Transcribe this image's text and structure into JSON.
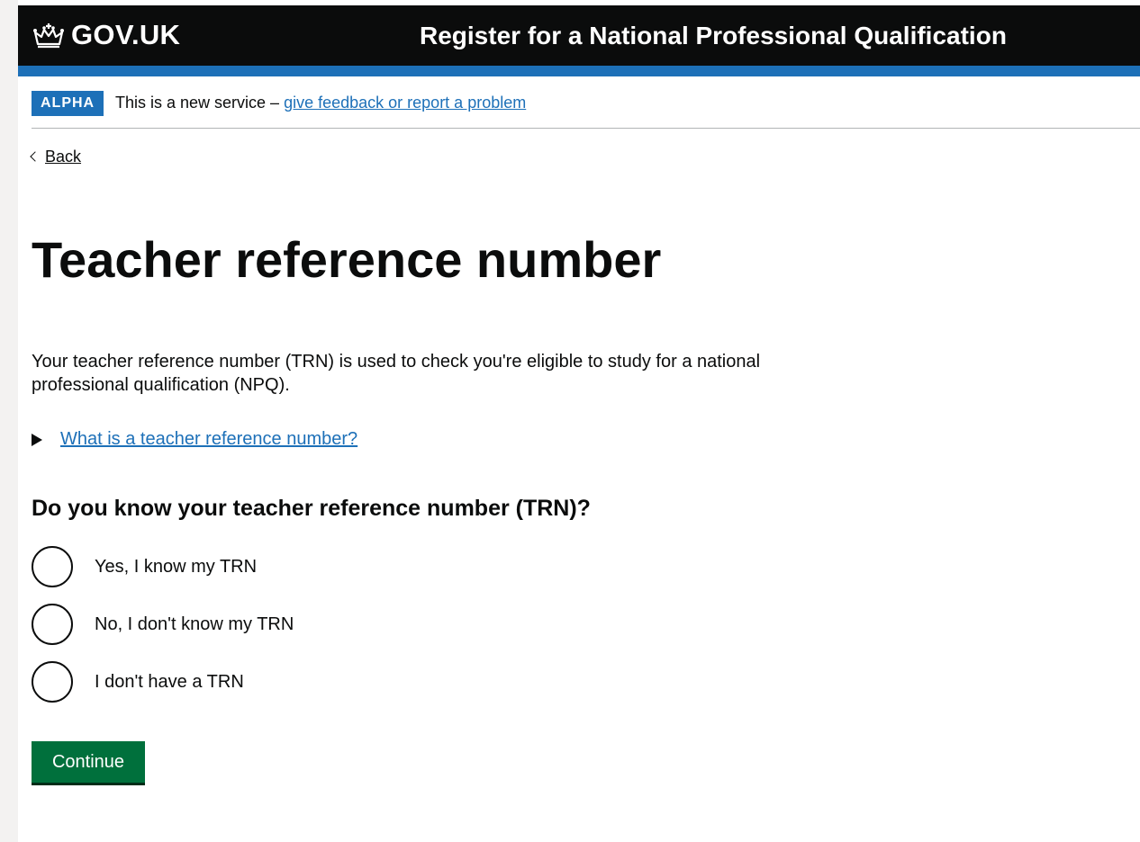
{
  "header": {
    "logo_text": "GOV.UK",
    "service_name": "Register for a National Professional Qualification"
  },
  "phase_banner": {
    "tag": "ALPHA",
    "text": "This is a new service – ",
    "link": "give feedback or report a problem"
  },
  "back_link": "Back",
  "page_title": "Teacher reference number",
  "intro": "Your teacher reference number (TRN) is used to check you're eligible to study for a national professional qualification (NPQ).",
  "details_summary": "What is a teacher reference number?",
  "question": "Do you know your teacher reference number (TRN)?",
  "options": [
    {
      "label": "Yes, I know my TRN",
      "selected": false
    },
    {
      "label": "No, I don't know my TRN",
      "selected": false
    },
    {
      "label": "I don't have a TRN",
      "selected": false
    }
  ],
  "continue_button": "Continue",
  "colors": {
    "header_bg": "#0b0c0c",
    "brand_blue": "#1d70b8",
    "button_green": "#00703c",
    "text": "#0b0c0c"
  }
}
